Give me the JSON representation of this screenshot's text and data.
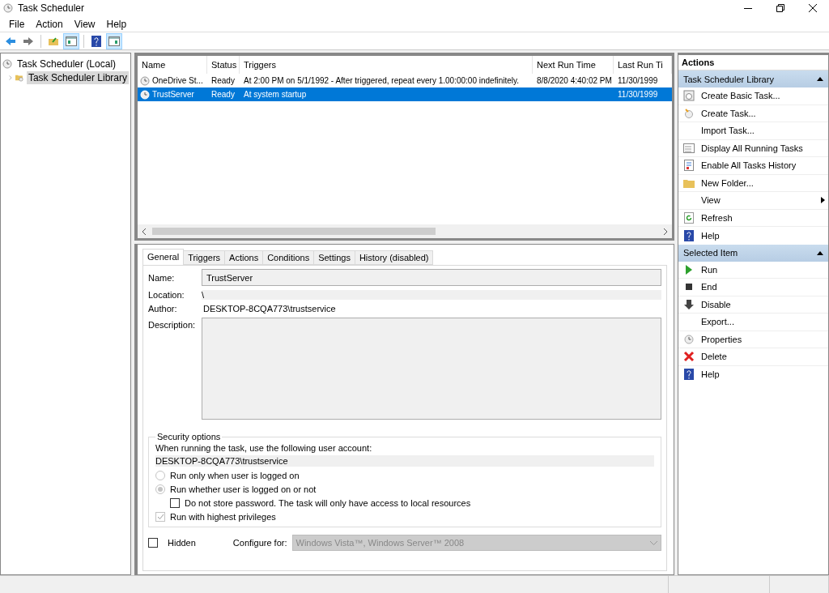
{
  "window": {
    "title": "Task Scheduler"
  },
  "menu": [
    "File",
    "Action",
    "View",
    "Help"
  ],
  "toolbar": [
    {
      "pressed": false
    },
    {
      "pressed": false
    },
    {
      "pressed": false
    },
    {
      "pressed": true
    },
    {
      "pressed": false
    },
    {
      "pressed": true
    }
  ],
  "tree": [
    {
      "label": "Task Scheduler (Local)",
      "children": [
        {
          "label": "Task Scheduler Library",
          "selected": true,
          "expanded": false
        }
      ]
    }
  ],
  "table": {
    "columns": [
      "Name",
      "Status",
      "Triggers",
      "Next Run Time",
      "Last Run Ti"
    ],
    "rows": [
      {
        "cells": [
          "OneDrive St...",
          "Ready",
          "At 2:00 PM on 5/1/1992 - After triggered, repeat every 1.00:00:00 indefinitely.",
          "8/8/2020 4:40:02 PM",
          "11/30/1999"
        ],
        "selected": false
      },
      {
        "cells": [
          "TrustServer",
          "Ready",
          "At system startup",
          "",
          "11/30/1999"
        ],
        "selected": true
      }
    ]
  },
  "tabs": [
    {
      "label": "General",
      "selected": true
    },
    {
      "label": "Triggers",
      "selected": false
    },
    {
      "label": "Actions",
      "selected": false
    },
    {
      "label": "Conditions",
      "selected": false
    },
    {
      "label": "Settings",
      "selected": false
    },
    {
      "label": "History (disabled)",
      "selected": false
    }
  ],
  "fields": [
    {
      "kind": "input",
      "label": "Name:",
      "value": "TrustServer"
    },
    {
      "kind": "readonly",
      "label": "Location:",
      "value": "\\"
    },
    {
      "kind": "text",
      "label": "Author:",
      "value": "DESKTOP-8CQA773\\trustservice"
    },
    {
      "kind": "textarea",
      "label": "Description:"
    }
  ],
  "security": {
    "title": "Security options",
    "prompt": "When running the task, use the following user account:",
    "account": "DESKTOP-8CQA773\\trustservice",
    "options": [
      {
        "kind": "radio",
        "label": "Run only when user is logged on",
        "selected": false
      },
      {
        "kind": "radio",
        "label": "Run whether user is logged on or not",
        "selected": true,
        "children": [
          {
            "kind": "checkbox",
            "label": "Do not store password.  The task will only have access to local resources",
            "checked": false
          }
        ]
      },
      {
        "kind": "checkbox",
        "label": "Run with highest privileges",
        "checked": true
      }
    ]
  },
  "hidden": {
    "label": "Hidden",
    "checked": false
  },
  "configure": {
    "label": "Configure for:",
    "value": "Windows Vista™, Windows Server™ 2008"
  },
  "actions": {
    "title": "Actions",
    "sections": [
      {
        "title": "Task Scheduler Library",
        "expanded": true,
        "items": [
          {
            "label": "Create Basic Task..."
          },
          {
            "label": "Create Task..."
          },
          {
            "label": "Import Task..."
          },
          {
            "label": "Display All Running Tasks"
          },
          {
            "label": "Enable All Tasks History"
          },
          {
            "label": "New Folder..."
          },
          {
            "label": "View",
            "submenu": true
          },
          {
            "label": "Refresh"
          },
          {
            "label": "Help"
          }
        ]
      },
      {
        "title": "Selected Item",
        "expanded": true,
        "items": [
          {
            "label": "Run"
          },
          {
            "label": "End"
          },
          {
            "label": "Disable"
          },
          {
            "label": "Export..."
          },
          {
            "label": "Properties"
          },
          {
            "label": "Delete"
          },
          {
            "label": "Help"
          }
        ]
      }
    ]
  }
}
